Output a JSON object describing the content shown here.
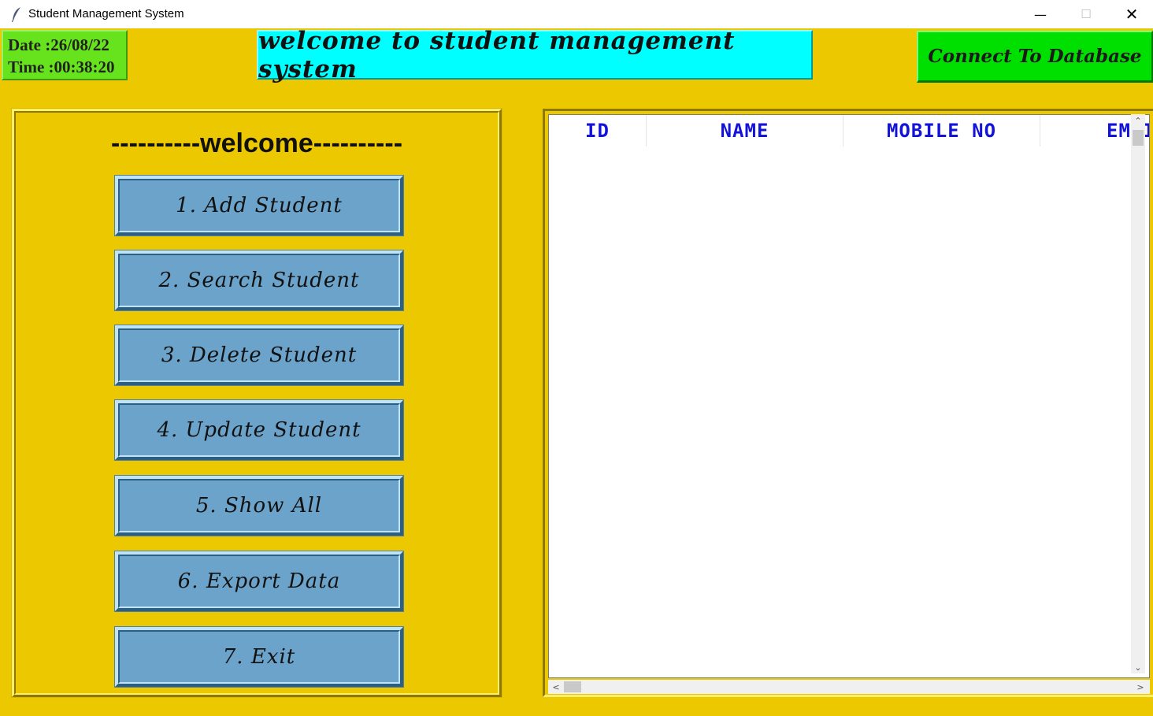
{
  "window": {
    "title": "Student Management System",
    "minimize_glyph": "—",
    "maximize_glyph": "☐",
    "close_glyph": "✕"
  },
  "header": {
    "date_label": "Date :26/08/22",
    "time_label": "Time :00:38:20",
    "banner": "welcome to student management system",
    "connect_button": "Connect To Database"
  },
  "menu": {
    "heading": "----------welcome----------",
    "buttons": [
      "1. Add Student",
      "2. Search Student",
      "3. Delete Student",
      "4. Update Student",
      "5. Show All",
      "6. Export Data",
      "7. Exit"
    ]
  },
  "table": {
    "columns": [
      "ID",
      "NAME",
      "MOBILE NO",
      "EMAIL"
    ],
    "rows": []
  },
  "scroll": {
    "up": "⌃",
    "down": "⌄",
    "left": "<",
    "right": ">"
  },
  "colors": {
    "background": "#ecc800",
    "banner": "#00ffff",
    "connect": "#00e000",
    "datetime": "#66e31c",
    "menu_button": "#6ca3ca",
    "column_header_text": "#1414d8"
  },
  "icons": {
    "app": "feather-icon"
  }
}
